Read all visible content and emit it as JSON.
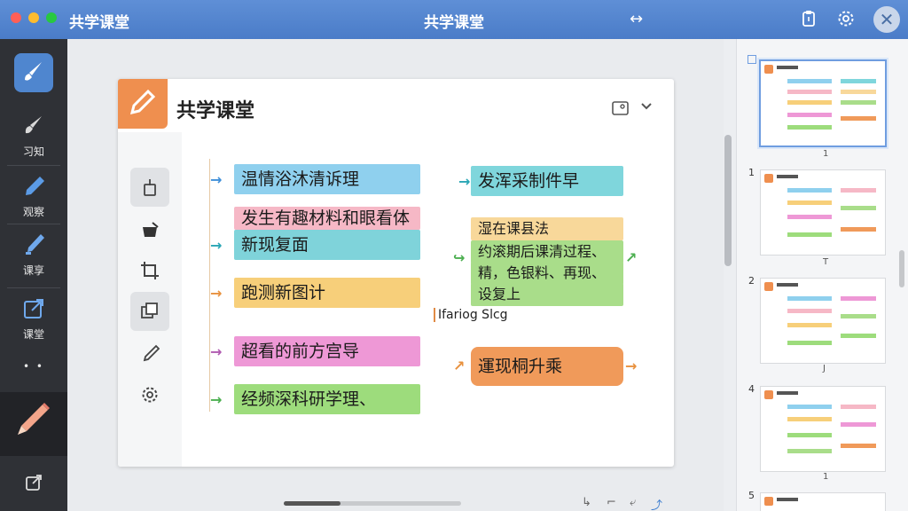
{
  "titlebar": {
    "app_name": "共学课堂",
    "window_title": "共学课堂",
    "traffic_colors": [
      "#ff5f57",
      "#febc2e",
      "#28c840"
    ],
    "close_glyph": "✕",
    "swap_glyph": "↔"
  },
  "leftbar": {
    "items": [
      {
        "label": "习知",
        "icon": "brush-icon"
      },
      {
        "label": "观察",
        "icon": "pen-icon"
      },
      {
        "label": "课享",
        "icon": "marker-icon"
      },
      {
        "label": "课堂",
        "icon": "export-icon"
      }
    ],
    "more": "• •"
  },
  "card": {
    "title": "共学课堂",
    "left_strips": [
      {
        "text": "温情浴沐清诉理",
        "color": "#8fd0ee"
      },
      {
        "text": "发生有趣材料和眼看体",
        "color": "#f6b8c6"
      },
      {
        "text": "新现复面",
        "color": "#7fd3da"
      },
      {
        "text": "跑测新图计",
        "color": "#f7cf7a"
      },
      {
        "text": "超看的前方宫导",
        "color": "#ee98d6"
      },
      {
        "text": "经频深科研学理、",
        "color": "#9ddc7c"
      }
    ],
    "right_strips": [
      {
        "text": "发浑采制件早",
        "color": "#7fd6dc"
      },
      {
        "text": "湿在课县法",
        "color": "#f8d89a"
      },
      {
        "text": "约滚期后课清过程、",
        "color": "#a9dd8a"
      },
      {
        "text": "精，色银料、再现、",
        "color": "#a9dd8a"
      },
      {
        "text": "设复上",
        "color": "#a9dd8a"
      },
      {
        "text": "運现桐升乘",
        "color": "#f09a5a"
      }
    ],
    "float_label": "Ifariog Slcg",
    "arrow_colors": {
      "blue": "#3f8fd9",
      "orange": "#e8913e",
      "purple": "#b05ab0",
      "green": "#4caf50",
      "teal": "#2aa6b5"
    }
  },
  "thumbnails": {
    "items": [
      {
        "number": "",
        "caption": "1"
      },
      {
        "number": "1",
        "caption": "T"
      },
      {
        "number": "2",
        "caption": "J"
      },
      {
        "number": "4",
        "caption": "1"
      },
      {
        "number": "5",
        "caption": ""
      }
    ],
    "bar_colors": [
      "#8fd0ee",
      "#f6b8c6",
      "#f7cf7a",
      "#ee98d6",
      "#9ddc7c",
      "#f09a5a"
    ]
  }
}
